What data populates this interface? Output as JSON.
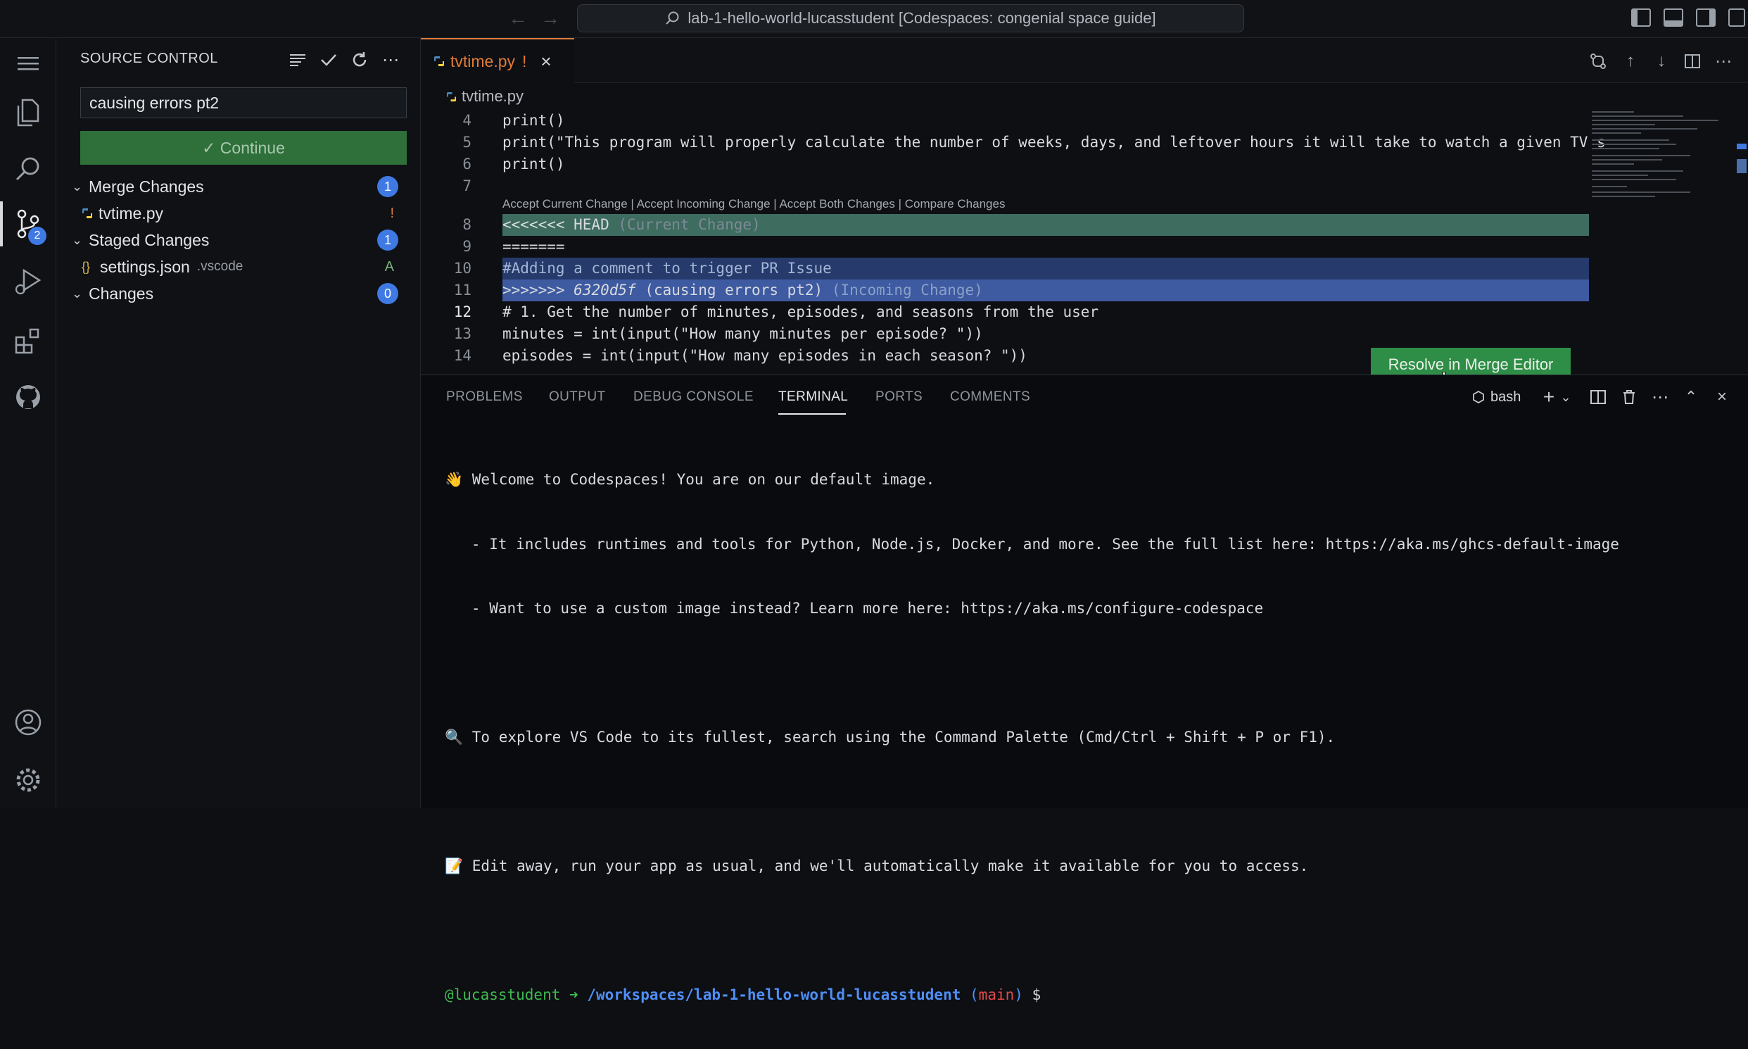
{
  "titlebar": {
    "command_center": "lab-1-hello-world-lucasstudent [Codespaces: congenial space guide]"
  },
  "activity_bar": {
    "source_control_badge": "2"
  },
  "sidebar": {
    "title": "SOURCE CONTROL",
    "commit_message": "causing errors pt2",
    "continue_label": "✓ Continue",
    "groups": {
      "merge": {
        "label": "Merge Changes",
        "count": "1",
        "file": "tvtime.py",
        "file_status": "!"
      },
      "staged": {
        "label": "Staged Changes",
        "count": "1",
        "file": "settings.json",
        "file_dir": ".vscode",
        "file_status": "A"
      },
      "changes": {
        "label": "Changes",
        "count": "0"
      }
    }
  },
  "editor": {
    "tab_label": "tvtime.py",
    "tab_status": "!",
    "breadcrumb": "tvtime.py",
    "codelens": "Accept Current Change | Accept Incoming Change | Accept Both Changes | Compare Changes",
    "lines": {
      "l4": {
        "num": "4",
        "text": "print()"
      },
      "l5": {
        "num": "5",
        "text": "print(\"This program will properly calculate the number of weeks, days, and leftover hours it will take to watch a given TV s"
      },
      "l6": {
        "num": "6",
        "text": "print()"
      },
      "l7": {
        "num": "7",
        "text": ""
      },
      "l8": {
        "num": "8",
        "text": "<<<<<<< HEAD",
        "hint": "(Current Change)"
      },
      "l9": {
        "num": "9",
        "text": "======="
      },
      "l10": {
        "num": "10",
        "text": "#Adding a comment to trigger PR Issue"
      },
      "l11": {
        "num": "11",
        "marker": ">>>>>>>",
        "sha": "6320d5f",
        "msg": "(causing errors pt2)",
        "hint": "(Incoming Change)"
      },
      "l12": {
        "num": "12",
        "text": "# 1. Get the number of minutes, episodes, and seasons from the user"
      },
      "l13": {
        "num": "13",
        "text": "minutes = int(input(\"How many minutes per episode? \"))"
      },
      "l14": {
        "num": "14",
        "text": "episodes = int(input(\"How many episodes in each season? \"))"
      }
    },
    "resolve_button": "Resolve in Merge Editor"
  },
  "panel": {
    "tabs": {
      "problems": "PROBLEMS",
      "output": "OUTPUT",
      "debug": "DEBUG CONSOLE",
      "terminal": "TERMINAL",
      "ports": "PORTS",
      "comments": "COMMENTS"
    },
    "shell": "bash",
    "terminal": {
      "l1": "👋 Welcome to Codespaces! You are on our default image.",
      "l2": "   - It includes runtimes and tools for Python, Node.js, Docker, and more. See the full list here: https://aka.ms/ghcs-default-image",
      "l3": "   - Want to use a custom image instead? Learn more here: https://aka.ms/configure-codespace",
      "l4": "🔍 To explore VS Code to its fullest, search using the Command Palette (Cmd/Ctrl + Shift + P or F1).",
      "l5": "📝 Edit away, run your app as usual, and we'll automatically make it available for you to access.",
      "prompt_user": "@lucasstudent",
      "prompt_arrow": "➜",
      "prompt_path": "/workspaces/lab-1-hello-world-lucasstudent",
      "prompt_open": "(",
      "prompt_branch": "main",
      "prompt_close": ")",
      "prompt_symbol": "$"
    }
  },
  "colors": {
    "current_change": "#3e6c5f",
    "incoming_change": "#263a6b",
    "resolve_button": "#2e8d46",
    "continue_button": "#2f6f3a",
    "badge": "#3f79e4",
    "conflict": "#e07b39"
  }
}
